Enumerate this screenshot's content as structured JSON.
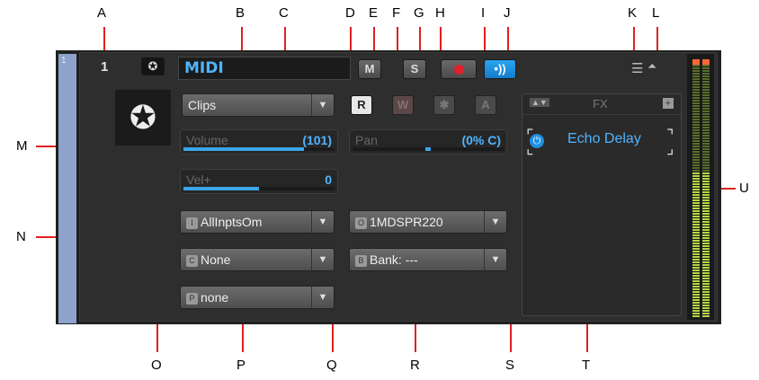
{
  "callouts": {
    "A": "A",
    "B": "B",
    "C": "C",
    "D": "D",
    "E": "E",
    "F": "F",
    "G": "G",
    "H": "H",
    "I": "I",
    "J": "J",
    "K": "K",
    "L": "L",
    "M": "M",
    "N": "N",
    "O": "O",
    "P": "P",
    "Q": "Q",
    "R": "R",
    "S": "S",
    "T": "T",
    "U": "U"
  },
  "track": {
    "strip_number": "1",
    "number": "1",
    "name": "MIDI",
    "icon": "midi-din-icon",
    "mute_label": "M",
    "solo_label": "S",
    "clips_label": "Clips",
    "read_label": "R",
    "write_label": "W",
    "archive_label": "A"
  },
  "volume": {
    "label": "Volume",
    "value": "(101)",
    "level": 0.8
  },
  "pan": {
    "label": "Pan",
    "value": "(0% C)",
    "level": 0.5
  },
  "velocity": {
    "label": "Vel+",
    "value": "0",
    "level": 0.5
  },
  "routing": {
    "input_tag": "I",
    "input": "AllInptsOm",
    "output_tag": "O",
    "output": "1MDSPR220",
    "channel_tag": "C",
    "channel": "None",
    "bank_tag": "B",
    "bank": "Bank: ---",
    "patch_tag": "P",
    "patch": "none"
  },
  "fx": {
    "title": "FX",
    "plugin": "Echo Delay"
  },
  "colors": {
    "accent": "#4fb4ff",
    "record": "#e0202a",
    "echo": "#1d8fe0",
    "strip": "#8da3cc"
  }
}
